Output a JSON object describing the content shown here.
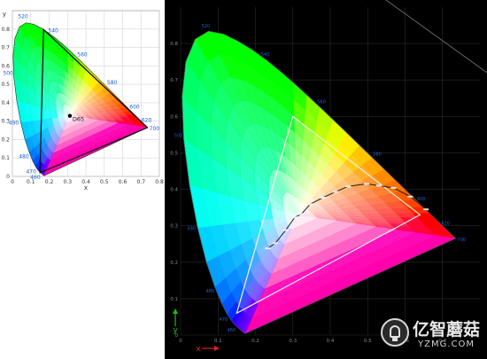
{
  "chart_data": [
    {
      "type": "scatter",
      "title": "",
      "xlabel": "x",
      "ylabel": "y",
      "xlim": [
        0,
        0.8
      ],
      "ylim": [
        0,
        0.9
      ],
      "x_ticks": [
        "0",
        "0.1",
        "0.2",
        "0.3",
        "0.4",
        "0.5",
        "0.6",
        "0.7",
        "0.8"
      ],
      "y_ticks": [
        "0",
        "0.1",
        "0.2",
        "0.3",
        "0.4",
        "0.5",
        "0.6",
        "0.7",
        "0.8"
      ],
      "grid": true,
      "spectral_locus_labels": [
        "460",
        "470",
        "480",
        "490",
        "500",
        "520",
        "540",
        "560",
        "580",
        "600",
        "620",
        "700"
      ],
      "points": [
        {
          "label": "D65",
          "x": 0.3127,
          "y": 0.329
        }
      ],
      "triangle": [
        [
          0.17,
          0.797
        ],
        [
          0.735,
          0.265
        ],
        [
          0.15,
          0.02
        ]
      ]
    },
    {
      "type": "scatter",
      "title": "",
      "xlabel": "x",
      "ylabel": "y",
      "xlim": [
        0,
        0.8
      ],
      "ylim": [
        0,
        0.9
      ],
      "x_ticks": [
        "0",
        "0.1",
        "0.2",
        "0.3",
        "0.4",
        "0.5",
        "0.6",
        "0.7"
      ],
      "y_ticks": [
        "0",
        "0.1",
        "0.2",
        "0.3",
        "0.4",
        "0.5",
        "0.6",
        "0.7",
        "0.8"
      ],
      "grid": true,
      "spectral_locus_labels": [
        "460",
        "470",
        "480",
        "490",
        "500",
        "520",
        "540",
        "560",
        "580",
        "600",
        "620",
        "700"
      ],
      "triangle": [
        [
          0.64,
          0.33
        ],
        [
          0.3,
          0.6
        ],
        [
          0.15,
          0.06
        ]
      ],
      "planckian_locus": [
        [
          0.233,
          0.238
        ],
        [
          0.253,
          0.252
        ],
        [
          0.281,
          0.288
        ],
        [
          0.305,
          0.323
        ],
        [
          0.323,
          0.332
        ],
        [
          0.346,
          0.359
        ],
        [
          0.38,
          0.377
        ],
        [
          0.414,
          0.393
        ],
        [
          0.448,
          0.408
        ],
        [
          0.497,
          0.415
        ],
        [
          0.53,
          0.41
        ],
        [
          0.569,
          0.404
        ],
        [
          0.614,
          0.38
        ],
        [
          0.656,
          0.345
        ]
      ]
    }
  ],
  "watermark": {
    "name": "亿智蘑菇",
    "url": "YZMG.COM"
  },
  "colors": {
    "wavelength_label": "#1a5fd6",
    "right_grid": "#2a2a2a",
    "right_tick": "#888888",
    "y_axis_arrow": "#18c018",
    "x_axis_arrow": "#e02020"
  }
}
